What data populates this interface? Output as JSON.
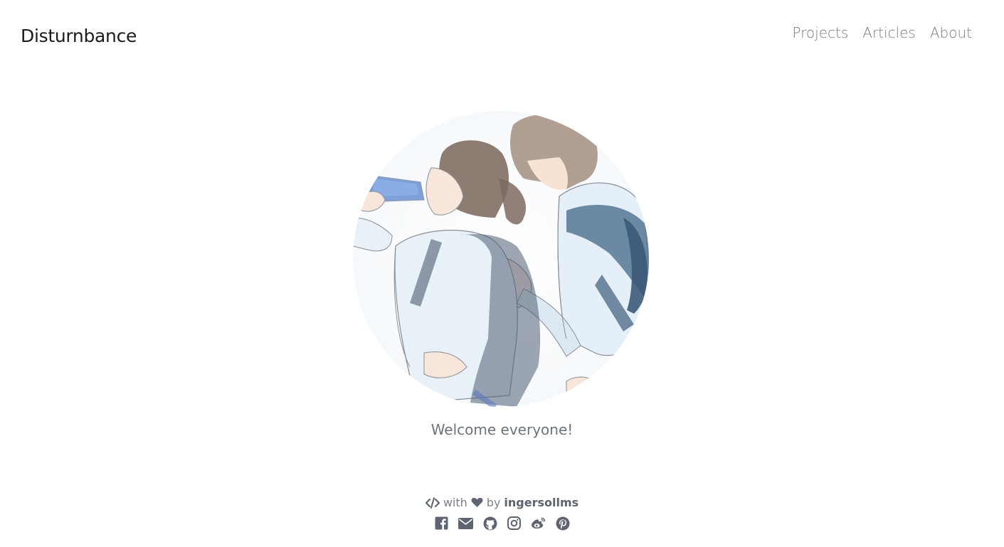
{
  "header": {
    "brand": "Disturnbance",
    "nav": [
      {
        "label": "Projects"
      },
      {
        "label": "Articles"
      },
      {
        "label": "About"
      }
    ]
  },
  "hero": {
    "welcome": "Welcome everyone!"
  },
  "footer": {
    "credit_with": "with",
    "credit_by": "by",
    "author": "ingersollms",
    "socials": [
      {
        "icon": "facebook-icon"
      },
      {
        "icon": "mail-icon"
      },
      {
        "icon": "github-icon"
      },
      {
        "icon": "instagram-icon"
      },
      {
        "icon": "weibo-icon"
      },
      {
        "icon": "pinterest-icon"
      }
    ]
  },
  "colors": {
    "brand_text": "#1b1b1b",
    "nav_text": "#7a7a7a",
    "muted_text": "#6c737c",
    "icon": "#5e6570"
  }
}
